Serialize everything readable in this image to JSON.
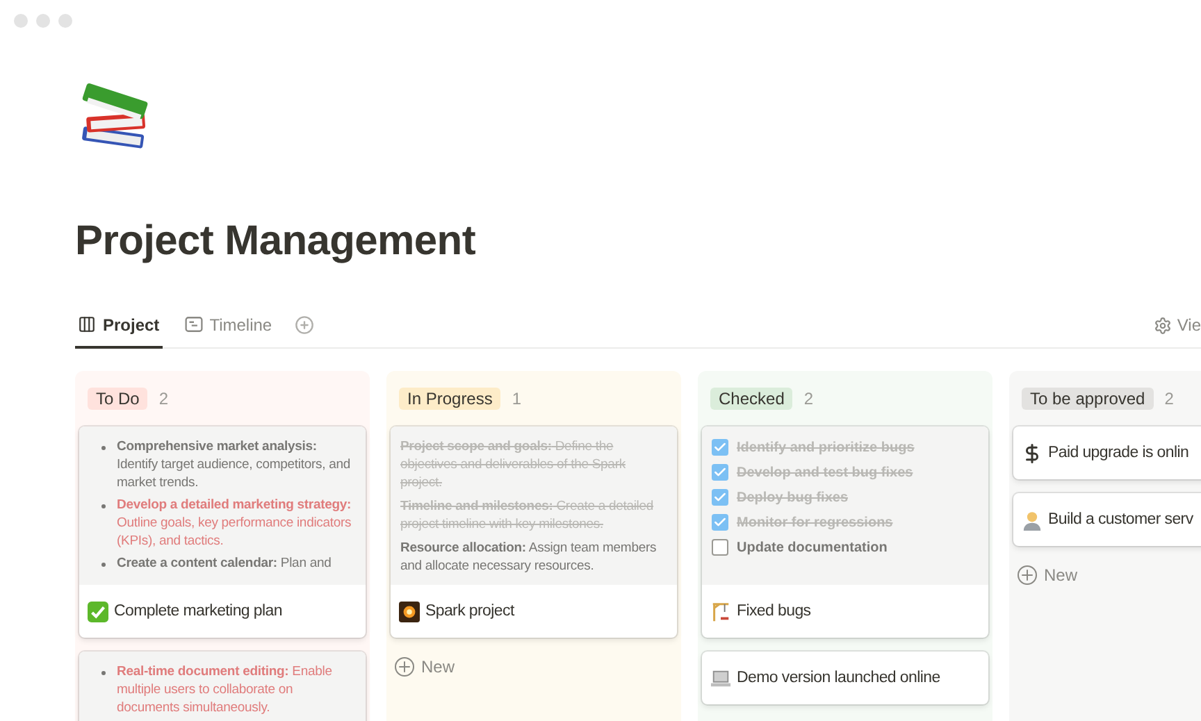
{
  "page": {
    "title": "Project Management"
  },
  "tabs": [
    {
      "label": "Project",
      "selected": true
    },
    {
      "label": "Timeline",
      "selected": false
    }
  ],
  "view_button": "Vie",
  "columns": [
    {
      "title": "To Do",
      "count": "2",
      "color": "#ffe2dd",
      "cards": [
        {
          "title": "Complete marketing plan",
          "preview": {
            "kind": "bullets",
            "items": [
              {
                "text": "**Comprehensive market analysis:** Identify target audience, competitors, and market trends.",
                "color": "#787774"
              },
              {
                "text": "**Develop a detailed marketing strategy:** Outline goals, key performance indicators (KPIs), and tactics.",
                "color": "#e07c7c"
              },
              {
                "text": "**Create a content calendar:** Plan and",
                "color": "#787774"
              }
            ]
          }
        },
        {
          "preview": {
            "kind": "bullets",
            "items": [
              {
                "text": "**Real-time document editing:** Enable multiple users to collaborate on documents simultaneously.",
                "color": "#e07c7c"
              }
            ]
          }
        }
      ]
    },
    {
      "title": "In Progress",
      "count": "1",
      "color": "#fdecc8",
      "new_label": "New",
      "cards": [
        {
          "title": "Spark project",
          "preview": {
            "kind": "paragraphs",
            "items": [
              {
                "text": "**Project scope and goals:** Define the objectives and deliverables of the Spark project.",
                "done": true
              },
              {
                "text": "**Timeline and milestones:** Create a detailed project timeline with key milestones.",
                "done": true
              },
              {
                "text": "**Resource allocation:** Assign team members and allocate necessary resources.",
                "done": false
              }
            ]
          }
        }
      ]
    },
    {
      "title": "Checked",
      "count": "2",
      "color": "#dbeddb",
      "cards": [
        {
          "title": "Fixed bugs",
          "preview": {
            "kind": "checklist",
            "items": [
              {
                "text": "Identify and prioritize bugs",
                "checked": true
              },
              {
                "text": "Develop and test bug fixes",
                "checked": true
              },
              {
                "text": "Deploy bug fixes",
                "checked": true
              },
              {
                "text": "Monitor for regressions",
                "checked": true
              },
              {
                "text": "Update documentation",
                "checked": false
              }
            ]
          }
        },
        {
          "title": "Demo version launched online"
        }
      ]
    },
    {
      "title": "To be approved",
      "count": "2",
      "color": "#e3e2e0",
      "new_label": "New",
      "cards": [
        {
          "title": "Paid upgrade is onlin"
        },
        {
          "title": "Build a customer serv"
        }
      ]
    }
  ]
}
